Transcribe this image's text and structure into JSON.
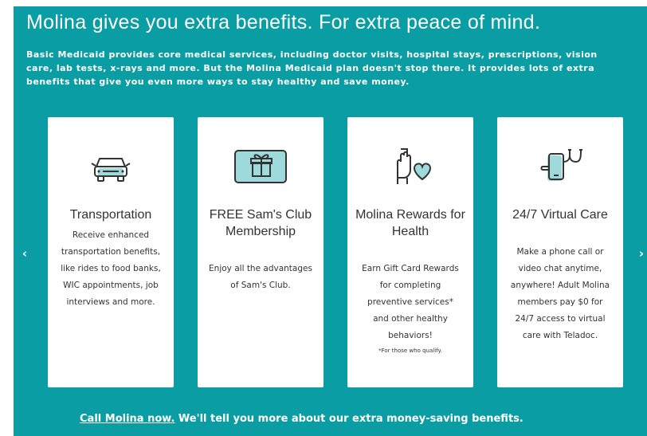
{
  "headline": "Molina gives you extra benefits. For extra peace of mind.",
  "intro": "Basic Medicaid provides core medical services, including doctor visits, hospital stays, prescriptions, vision care, lab tests, x-rays and more. But the Molina Medicaid plan doesn't stop there. It provides lots of extra benefits that give you even more ways to stay healthy and save money.",
  "cards": [
    {
      "icon": "car-icon",
      "title": "Transportation",
      "desc": "Receive enhanced transportation benefits, like rides to food banks, WIC appointments, job interviews and more.",
      "note": ""
    },
    {
      "icon": "gift-card-icon",
      "title": "FREE Sam's Club Membership",
      "desc": "Enjoy all the advantages of Sam's Club.",
      "note": ""
    },
    {
      "icon": "hand-heart-icon",
      "title": "Molina Rewards for Health",
      "desc": "Earn Gift Card Rewards for completing preventive services* and other healthy behaviors!",
      "note": "*For those who qualify."
    },
    {
      "icon": "phone-stethoscope-icon",
      "title": "24/7 Virtual Care",
      "desc": "Make a phone call or video chat anytime, anywhere! Adult Molina members pay $0 for 24/7 access to virtual care with Teladoc.",
      "note": ""
    }
  ],
  "carousel": {
    "prev": "‹",
    "next": "›"
  },
  "cta": {
    "link": "Call Molina now.",
    "text": " We'll tell you more about our extra money-saving benefits."
  },
  "colors": {
    "background": "#0A9DA4",
    "card": "#FFFFFF",
    "icon_fill": "#9ED9DC",
    "icon_stroke": "#333333"
  }
}
